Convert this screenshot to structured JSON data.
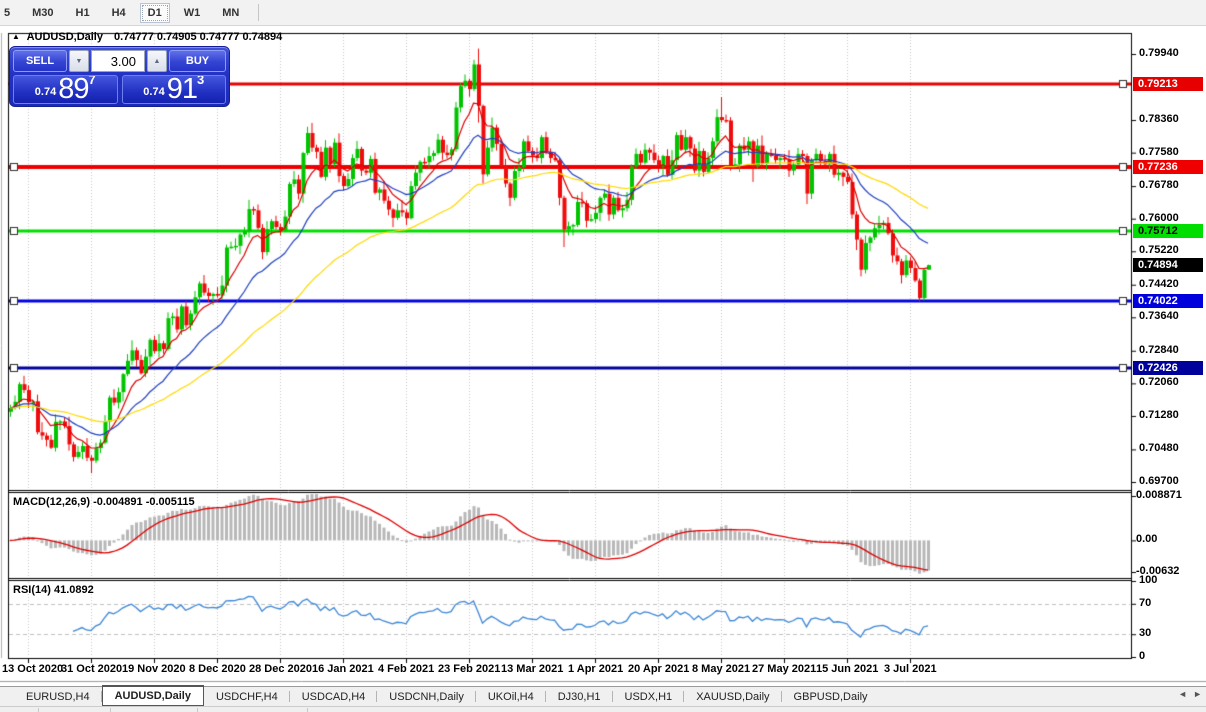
{
  "toolbar": {
    "timeframes": [
      "5",
      "M30",
      "H1",
      "H4",
      "D1",
      "W1",
      "MN"
    ],
    "active_timeframe": "D1"
  },
  "chart_header": {
    "collapse_icon": "▲",
    "symbol": "AUDUSD,Daily",
    "ohlc_text": "0.74777 0.74905 0.74777 0.74894"
  },
  "trade_panel": {
    "sell_label": "SELL",
    "buy_label": "BUY",
    "volume": "3.00",
    "spinner_down_icon": "▼",
    "spinner_up_icon": "▲",
    "sell_price": {
      "prefix": "0.74",
      "big": "89",
      "sup": "7"
    },
    "buy_price": {
      "prefix": "0.74",
      "big": "91",
      "sup": "3"
    }
  },
  "chart_data": {
    "type": "candlestick",
    "title": "AUDUSD,Daily",
    "x_labels": [
      "13 Oct 2020",
      "31 Oct 2020",
      "19 Nov 2020",
      "8 Dec 2020",
      "28 Dec 2020",
      "16 Jan 2021",
      "4 Feb 2021",
      "23 Feb 2021",
      "13 Mar 2021",
      "1 Apr 2021",
      "20 Apr 2021",
      "8 May 2021",
      "27 May 2021",
      "15 Jun 2021",
      "3 Jul 2021"
    ],
    "x_gridline_indices": [
      4,
      18,
      32,
      46,
      60,
      74,
      88,
      102,
      116,
      130,
      144,
      158,
      172,
      186,
      200
    ],
    "price_ticks": [
      "0.79940",
      "0.78360",
      "0.77580",
      "0.76780",
      "0.76000",
      "0.75220",
      "0.74420",
      "0.73640",
      "0.72840",
      "0.72060",
      "0.71280",
      "0.70480",
      "0.69700"
    ],
    "ylim": [
      0.69509,
      0.80442
    ],
    "grid": "vertical-dotted",
    "colors": {
      "up": "#00c400",
      "down": "#ee0c0c",
      "ma_fast": "#dd0000",
      "ma_mid": "#2040c0",
      "ma_slow": "#ffd900",
      "grid": "#c8c8c8",
      "frame": "#000000",
      "macd_hist": "#b8b8b8",
      "macd_signal": "#dd0000",
      "rsi_line": "#3d87d6"
    },
    "hlines": [
      {
        "price": 0.79213,
        "label": "0.79213",
        "color": "#e60000",
        "text": "#ffffff",
        "width": 3
      },
      {
        "price": 0.77236,
        "label": "0.77236",
        "color": "#ee0000",
        "text": "#ffffff",
        "width": 4
      },
      {
        "price": 0.75712,
        "label": "0.75712",
        "color": "#00dd00",
        "text": "#000000",
        "width": 3
      },
      {
        "price": 0.74022,
        "label": "0.74022",
        "color": "#0000dd",
        "text": "#ffffff",
        "width": 3
      },
      {
        "price": 0.72426,
        "label": "0.72426",
        "color": "#00009a",
        "text": "#ffffff",
        "width": 3
      }
    ],
    "current_price": {
      "value": 0.74894,
      "label": "0.74894",
      "bg": "#000000",
      "text": "#ffffff"
    },
    "candles": {
      "first_open": 0.7138,
      "closes": [
        0.7147,
        0.7162,
        0.7204,
        0.719,
        0.7161,
        0.7163,
        0.7089,
        0.7081,
        0.7071,
        0.7052,
        0.7114,
        0.7115,
        0.7104,
        0.706,
        0.703,
        0.7042,
        0.7056,
        0.7028,
        0.7021,
        0.7051,
        0.7064,
        0.7115,
        0.7172,
        0.716,
        0.7185,
        0.7228,
        0.726,
        0.7285,
        0.7262,
        0.723,
        0.727,
        0.731,
        0.7283,
        0.7302,
        0.7288,
        0.7362,
        0.7366,
        0.7335,
        0.739,
        0.7345,
        0.7373,
        0.7412,
        0.7445,
        0.7423,
        0.7415,
        0.742,
        0.7416,
        0.744,
        0.7531,
        0.7533,
        0.7535,
        0.7562,
        0.757,
        0.7623,
        0.762,
        0.7578,
        0.752,
        0.7575,
        0.7594,
        0.758,
        0.7572,
        0.7605,
        0.7683,
        0.7694,
        0.766,
        0.7757,
        0.7805,
        0.777,
        0.776,
        0.77,
        0.777,
        0.773,
        0.7782,
        0.7702,
        0.7678,
        0.7695,
        0.7745,
        0.7767,
        0.7715,
        0.771,
        0.7743,
        0.7662,
        0.767,
        0.7643,
        0.7622,
        0.7602,
        0.762,
        0.7615,
        0.7601,
        0.7678,
        0.771,
        0.7736,
        0.7735,
        0.775,
        0.7757,
        0.7789,
        0.7758,
        0.7752,
        0.7766,
        0.7866,
        0.7917,
        0.793,
        0.791,
        0.7969,
        0.787,
        0.7706,
        0.777,
        0.7818,
        0.7779,
        0.7725,
        0.7684,
        0.765,
        0.7714,
        0.7723,
        0.7785,
        0.7762,
        0.7751,
        0.7745,
        0.7795,
        0.776,
        0.7745,
        0.774,
        0.765,
        0.7574,
        0.7582,
        0.7585,
        0.764,
        0.7637,
        0.7595,
        0.7599,
        0.7614,
        0.765,
        0.766,
        0.761,
        0.765,
        0.762,
        0.7625,
        0.7645,
        0.7725,
        0.7755,
        0.7734,
        0.7765,
        0.7758,
        0.774,
        0.7725,
        0.775,
        0.7705,
        0.774,
        0.78,
        0.7765,
        0.7795,
        0.7768,
        0.7715,
        0.7762,
        0.7712,
        0.7745,
        0.7785,
        0.7843,
        0.7836,
        0.7835,
        0.7727,
        0.773,
        0.7775,
        0.7765,
        0.7785,
        0.7725,
        0.7775,
        0.7732,
        0.7755,
        0.775,
        0.774,
        0.7745,
        0.7742,
        0.7715,
        0.773,
        0.7755,
        0.775,
        0.766,
        0.774,
        0.7755,
        0.7738,
        0.773,
        0.7755,
        0.7705,
        0.771,
        0.77,
        0.7688,
        0.761,
        0.755,
        0.7478,
        0.7542,
        0.7555,
        0.7577,
        0.7585,
        0.759,
        0.7565,
        0.7512,
        0.7498,
        0.7465,
        0.75,
        0.7482,
        0.7452,
        0.741,
        0.7478,
        0.7489
      ],
      "wick_up_pattern": [
        8,
        15,
        5,
        20,
        11,
        3,
        16,
        24,
        7,
        12,
        18,
        4,
        10,
        22,
        6,
        14,
        9,
        19,
        5,
        13
      ],
      "wick_dn_pattern": [
        12,
        4,
        18,
        7,
        14,
        22,
        5,
        10,
        16,
        3,
        9,
        20,
        6,
        15,
        11,
        4,
        17,
        8,
        13,
        6
      ],
      "wick_overrides": {
        "18": [
          6,
          30
        ],
        "66": [
          15,
          5
        ],
        "103": [
          11,
          5
        ],
        "104": [
          38,
          40
        ],
        "123": [
          5,
          42
        ],
        "158": [
          48,
          6
        ],
        "165": [
          4,
          37
        ],
        "177": [
          6,
          25
        ],
        "187": [
          20,
          10
        ],
        "188": [
          8,
          25
        ],
        "189": [
          5,
          16
        ],
        "198": [
          6,
          20
        ],
        "202": [
          5,
          8
        ],
        "203": [
          4,
          6
        ],
        "204": [
          1,
          0
        ]
      }
    },
    "moving_averages": [
      {
        "name": "ma-fast",
        "period": 8,
        "color": "#dd0000"
      },
      {
        "name": "ma-mid",
        "period": 21,
        "color": "#2040c0"
      },
      {
        "name": "ma-slow",
        "period": 55,
        "color": "#ffd900"
      }
    ],
    "macd": {
      "label": "MACD(12,26,9)",
      "values_text": "-0.004891 -0.005115",
      "params": [
        12,
        26,
        9
      ],
      "axis_labels": [
        "0.008871",
        "0.00",
        "-0.00632"
      ],
      "ylim": [
        -0.00632,
        0.008871
      ]
    },
    "rsi": {
      "label": "RSI(14)",
      "value_text": "41.0892",
      "period": 14,
      "levels": [
        70,
        30
      ],
      "axis_labels": [
        "100",
        "70",
        "30",
        "0"
      ],
      "ylim": [
        0,
        100
      ]
    }
  },
  "tabs": {
    "items": [
      "EURUSD,H4",
      "AUDUSD,Daily",
      "USDCHF,H4",
      "USDCAD,H4",
      "USDCNH,Daily",
      "UKOil,H4",
      "DJ30,H1",
      "USDX,H1",
      "XAUUSD,Daily",
      "GBPUSD,Daily"
    ],
    "active": "AUDUSD,Daily",
    "scroll_left_icon": "◄",
    "scroll_right_icon": "►"
  }
}
